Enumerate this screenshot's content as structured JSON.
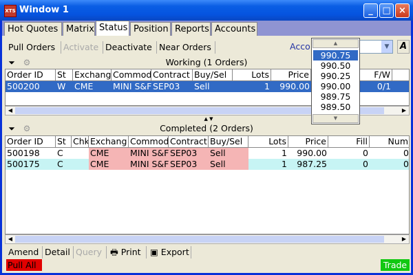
{
  "window": {
    "title": "Window 1",
    "app_icon_text": "XTS"
  },
  "tabs": [
    "Hot Quotes",
    "Matrix",
    "Status",
    "Position",
    "Reports",
    "Accounts"
  ],
  "toolbar": {
    "pull_orders": "Pull Orders",
    "activate": "Activate",
    "deactivate": "Deactivate",
    "near_orders": "Near Orders",
    "account_label": "Acco",
    "a_button": "A"
  },
  "working": {
    "title": "Working (1  Orders)",
    "headers": [
      "Order ID",
      "St",
      "Exchang",
      "Commod",
      "Contract",
      "Buy/Sel",
      "Lots",
      "Price",
      "",
      "F/W"
    ],
    "rows": [
      {
        "order_id": "500200",
        "st": "W",
        "exchange": "CME",
        "commodity": "MINI S&F",
        "contract": "SEP03",
        "buysell": "Sell",
        "lots": "1",
        "price": "990.00",
        "fw": "0/1"
      }
    ]
  },
  "completed": {
    "title": "Completed  (2 Orders)",
    "headers": [
      "Order ID",
      "St",
      "Chk",
      "Exchang",
      "Commod",
      "Contract",
      "Buy/Sel",
      "Lots",
      "Price",
      "Fill",
      "Num"
    ],
    "rows": [
      {
        "order_id": "500198",
        "st": "C",
        "chk": "",
        "exchange": "CME",
        "commodity": "MINI S&F",
        "contract": "SEP03",
        "buysell": "Sell",
        "lots": "1",
        "price": "990.00",
        "fill": "0",
        "num": "0"
      },
      {
        "order_id": "500175",
        "st": "C",
        "chk": "",
        "exchange": "CME",
        "commodity": "MINI S&F",
        "contract": "SEP03",
        "buysell": "Sell",
        "lots": "1",
        "price": "987.25",
        "fill": "0",
        "num": "0"
      }
    ]
  },
  "price_dropdown": {
    "items": [
      "990.75",
      "990.50",
      "990.25",
      "990.00",
      "989.75",
      "989.50"
    ],
    "selected_index": 0
  },
  "bottom": {
    "amend": "Amend",
    "detail": "Detail",
    "query": "Query",
    "print": "Print",
    "export": "Export",
    "pull_all": "Pull All",
    "trade": "Trade"
  },
  "colors": {
    "title_bar": "#0a5ee4",
    "selection": "#316ac5",
    "pink_cells": "#f5b5b5",
    "cyan_row": "#c7f4f4",
    "pull_all": "#e10000",
    "trade": "#11c811"
  }
}
